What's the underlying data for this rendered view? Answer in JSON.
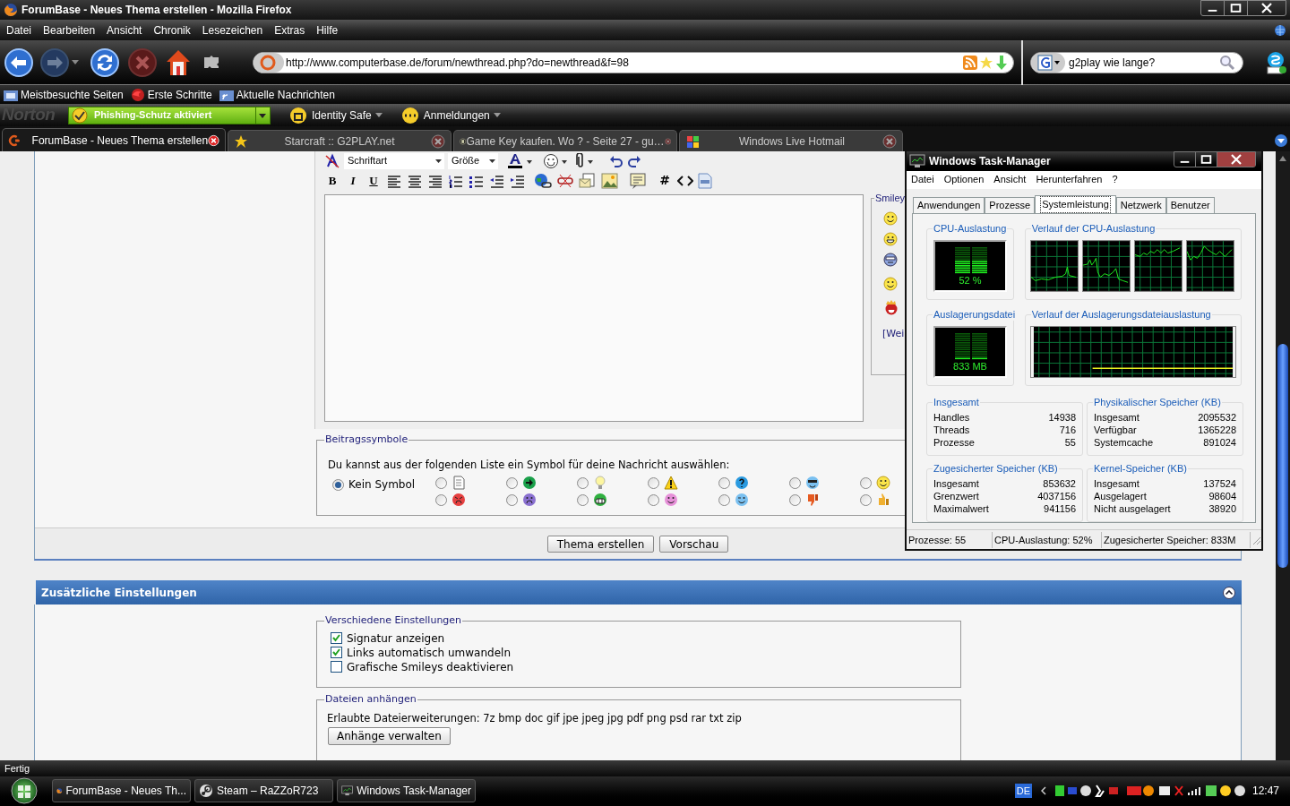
{
  "window": {
    "title": "ForumBase - Neues Thema erstellen - Mozilla Firefox"
  },
  "menu": [
    "Datei",
    "Bearbeiten",
    "Ansicht",
    "Chronik",
    "Lesezeichen",
    "Extras",
    "Hilfe"
  ],
  "navigation": {
    "url": "http://www.computerbase.de/forum/newthread.php?do=newthread&f=98",
    "search": "g2play wie lange?"
  },
  "bookmarks": [
    "Meistbesuchte Seiten",
    "Erste Schritte",
    "Aktuelle Nachrichten"
  ],
  "norton": {
    "logo": "Norton",
    "phishing": "Phishing-Schutz aktiviert",
    "items": [
      "Identity Safe",
      "Anmeldungen"
    ]
  },
  "tabs": [
    {
      "label": "ForumBase - Neues Thema erstellen",
      "selected": true
    },
    {
      "label": "Starcraft :: G2PLAY.net",
      "selected": false
    },
    {
      "label": "Game Key kaufen. Wo ? - Seite 27 - gu…",
      "selected": false
    },
    {
      "label": "Windows Live Hotmail",
      "selected": false
    }
  ],
  "editor": {
    "font": "Schriftart",
    "size": "Größe",
    "format_buttons": [
      "B",
      "I",
      "U"
    ],
    "hash_button": "#",
    "smilies_legend": "Smiley",
    "more_link": "[Wei"
  },
  "post_icons": {
    "legend": "Beitragssymbole",
    "instruction": "Du kannst aus der folgenden Liste ein Symbol für deine Nachricht auswählen:",
    "none_option": {
      "label": "Kein Symbol",
      "selected": true
    },
    "options": [
      {
        "kind": "document",
        "selected": false
      },
      {
        "kind": "arrow",
        "selected": false
      },
      {
        "kind": "bulb",
        "selected": false
      },
      {
        "kind": "warning",
        "selected": false
      },
      {
        "kind": "question",
        "selected": false
      },
      {
        "kind": "cool",
        "selected": false
      },
      {
        "kind": "smile",
        "selected": false
      },
      {
        "kind": "angry",
        "selected": false
      },
      {
        "kind": "sad",
        "selected": false
      },
      {
        "kind": "grin",
        "selected": false
      },
      {
        "kind": "blush",
        "selected": false
      },
      {
        "kind": "wink",
        "selected": false
      },
      {
        "kind": "thumbs-down",
        "selected": false
      },
      {
        "kind": "thumbs-up",
        "selected": false
      }
    ]
  },
  "buttons": [
    "Thema erstellen",
    "Vorschau"
  ],
  "additional": {
    "title": "Zusätzliche Einstellungen",
    "settings_legend": "Verschiedene Einstellungen",
    "settings": [
      {
        "label": "Signatur anzeigen",
        "checked": true
      },
      {
        "label": "Links automatisch umwandeln",
        "checked": true
      },
      {
        "label": "Grafische Smileys deaktivieren",
        "checked": false
      }
    ],
    "attachments_legend": "Dateien anhängen",
    "extensions": "Erlaubte Dateierweiterungen: 7z bmp doc gif jpe jpeg jpg pdf png psd rar txt zip",
    "manage_button": "Anhänge verwalten"
  },
  "status_bar": "Fertig",
  "task_manager": {
    "title": "Windows Task-Manager",
    "menu": [
      "Datei",
      "Optionen",
      "Ansicht",
      "Herunterfahren",
      "?"
    ],
    "tabs": [
      {
        "label": "Anwendungen",
        "selected": false
      },
      {
        "label": "Prozesse",
        "selected": false
      },
      {
        "label": "Systemleistung",
        "selected": true
      },
      {
        "label": "Netzwerk",
        "selected": false
      },
      {
        "label": "Benutzer",
        "selected": false
      }
    ],
    "cpu": {
      "title": "CPU-Auslastung",
      "reading": "52 %",
      "level": 0.52
    },
    "cpu_history_title": "Verlauf der CPU-Auslastung",
    "pagefile": {
      "title": "Auslagerungsdatei",
      "reading": "833 MB",
      "level": 0.1
    },
    "pagefile_history_title": "Verlauf der Auslagerungsdateiauslastung",
    "groups": [
      {
        "title": "Insgesamt",
        "rows": [
          {
            "label": "Handles",
            "value": "14938"
          },
          {
            "label": "Threads",
            "value": "716"
          },
          {
            "label": "Prozesse",
            "value": "55"
          }
        ]
      },
      {
        "title": "Physikalischer Speicher (KB)",
        "rows": [
          {
            "label": "Insgesamt",
            "value": "2095532"
          },
          {
            "label": "Verfügbar",
            "value": "1365228"
          },
          {
            "label": "Systemcache",
            "value": "891024"
          }
        ]
      },
      {
        "title": "Zugesicherter Speicher (KB)",
        "rows": [
          {
            "label": "Insgesamt",
            "value": "853632"
          },
          {
            "label": "Grenzwert",
            "value": "4037156"
          },
          {
            "label": "Maximalwert",
            "value": "941156"
          }
        ]
      },
      {
        "title": "Kernel-Speicher (KB)",
        "rows": [
          {
            "label": "Insgesamt",
            "value": "137524"
          },
          {
            "label": "Ausgelagert",
            "value": "98604"
          },
          {
            "label": "Nicht ausgelagert",
            "value": "38920"
          }
        ]
      }
    ],
    "status": [
      "Prozesse: 55",
      "CPU-Auslastung: 52%",
      "Zugesicherter Speicher: 833M"
    ]
  },
  "taskbar": {
    "buttons": [
      "ForumBase - Neues Th...",
      "Steam – RaZZoR723",
      "Windows Task-Manager"
    ],
    "language": "DE",
    "clock": "12:47"
  }
}
